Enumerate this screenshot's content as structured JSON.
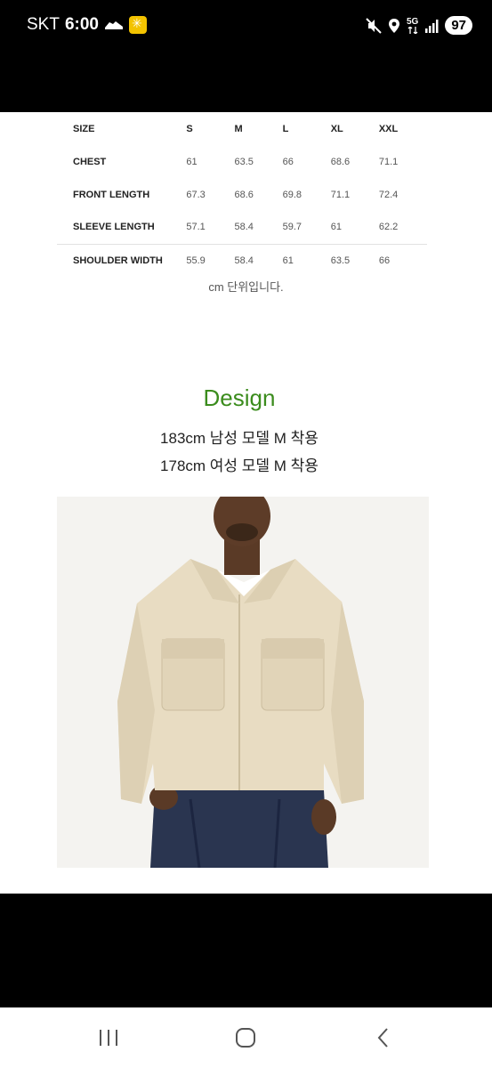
{
  "status_bar": {
    "carrier": "SKT",
    "time": "6:00",
    "network": "5G",
    "battery": "97"
  },
  "size_table": {
    "rows": [
      {
        "label": "SIZE",
        "values": [
          "S",
          "M",
          "L",
          "XL",
          "XXL"
        ]
      },
      {
        "label": "CHEST",
        "values": [
          "61",
          "63.5",
          "66",
          "68.6",
          "71.1"
        ]
      },
      {
        "label": "FRONT LENGTH",
        "values": [
          "67.3",
          "68.6",
          "69.8",
          "71.1",
          "72.4"
        ]
      },
      {
        "label": "SLEEVE LENGTH",
        "values": [
          "57.1",
          "58.4",
          "59.7",
          "61",
          "62.2"
        ]
      },
      {
        "label": "SHOULDER WIDTH",
        "values": [
          "55.9",
          "58.4",
          "61",
          "63.5",
          "66"
        ]
      }
    ],
    "unit_note": "cm 단위입니다."
  },
  "design": {
    "title": "Design",
    "model_male": "183cm 남성 모델 M 착용",
    "model_female": "178cm 여성 모델 M 착용"
  },
  "colors": {
    "design_title": "#3b8c1d",
    "jacket": "#e8dcc2",
    "jeans": "#2a3550"
  },
  "icons": {
    "recent_apps": "recent-apps-icon",
    "home": "home-icon",
    "back": "back-icon"
  }
}
